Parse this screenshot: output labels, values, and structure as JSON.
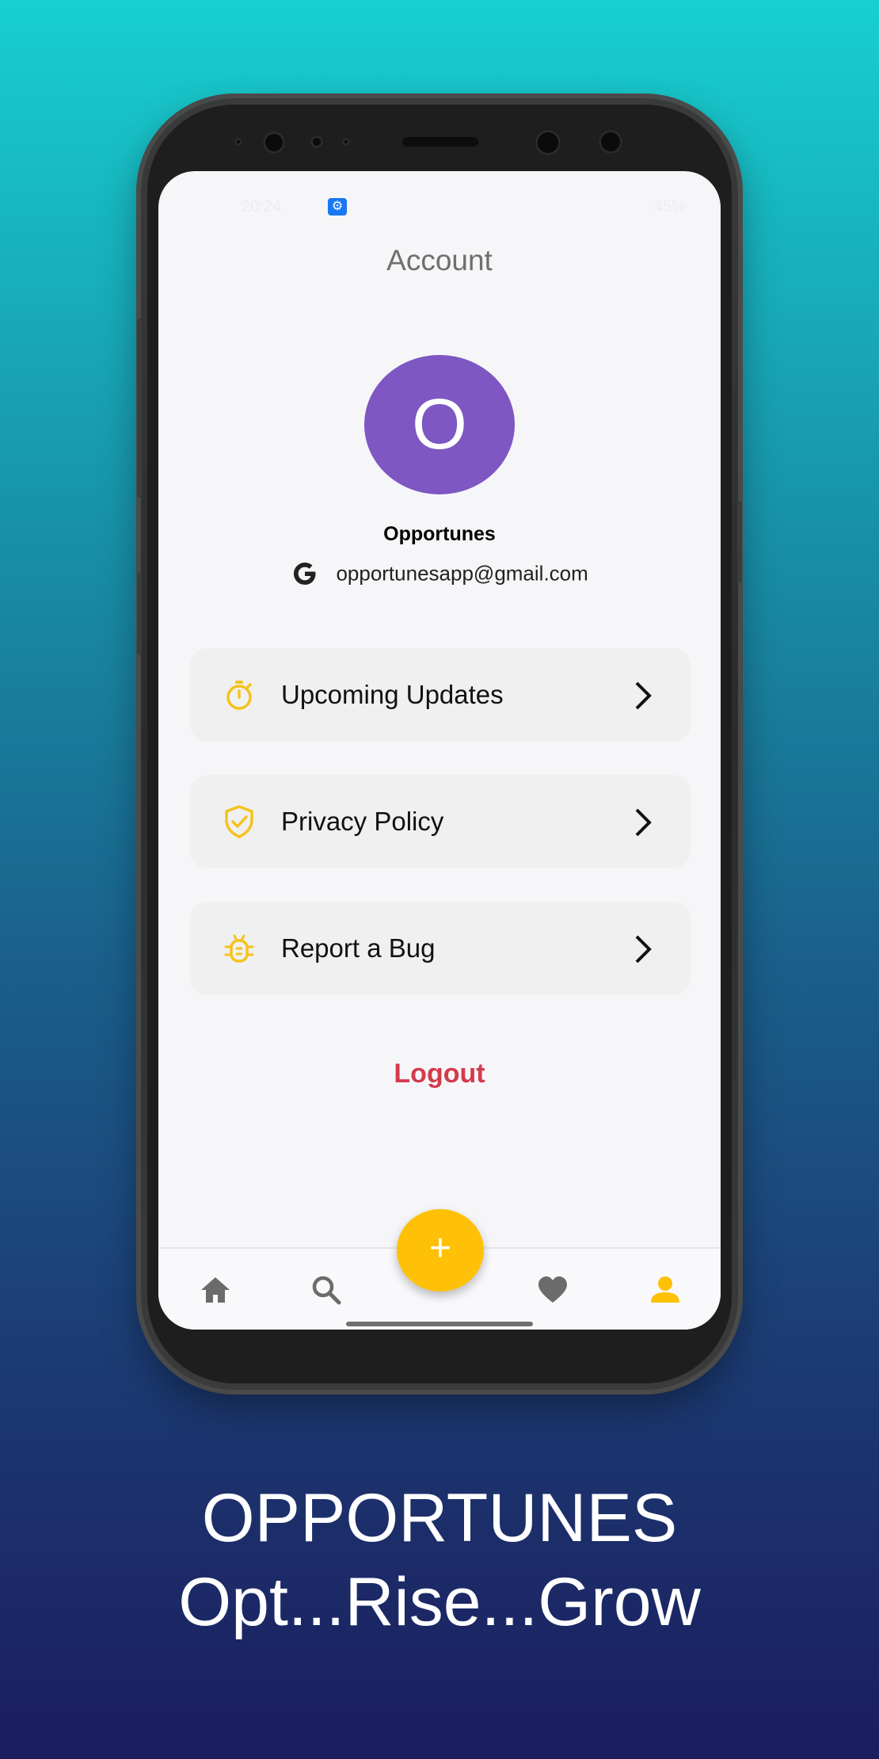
{
  "status_bar": {
    "time": "20:24",
    "battery": "45%"
  },
  "header": {
    "title": "Account"
  },
  "profile": {
    "avatar_letter": "O",
    "name": "Opportunes",
    "email": "opportunesapp@gmail.com",
    "avatar_color": "#7e57c2"
  },
  "menu": {
    "items": [
      {
        "label": "Upcoming Updates",
        "icon": "stopwatch-icon"
      },
      {
        "label": "Privacy Policy",
        "icon": "shield-check-icon"
      },
      {
        "label": "Report a Bug",
        "icon": "bug-icon"
      }
    ]
  },
  "logout_label": "Logout",
  "fab_label": "+",
  "bottom_nav": {
    "items": [
      {
        "icon": "home-icon",
        "active": false
      },
      {
        "icon": "search-icon",
        "active": false
      },
      {
        "icon": "heart-icon",
        "active": false
      },
      {
        "icon": "person-icon",
        "active": true
      }
    ]
  },
  "promo": {
    "brand": "OPPORTUNES",
    "tagline": "Opt...Rise...Grow"
  },
  "colors": {
    "accent": "#ffc107",
    "logout": "#d33b4b",
    "nav_inactive": "#6b6b6b"
  }
}
